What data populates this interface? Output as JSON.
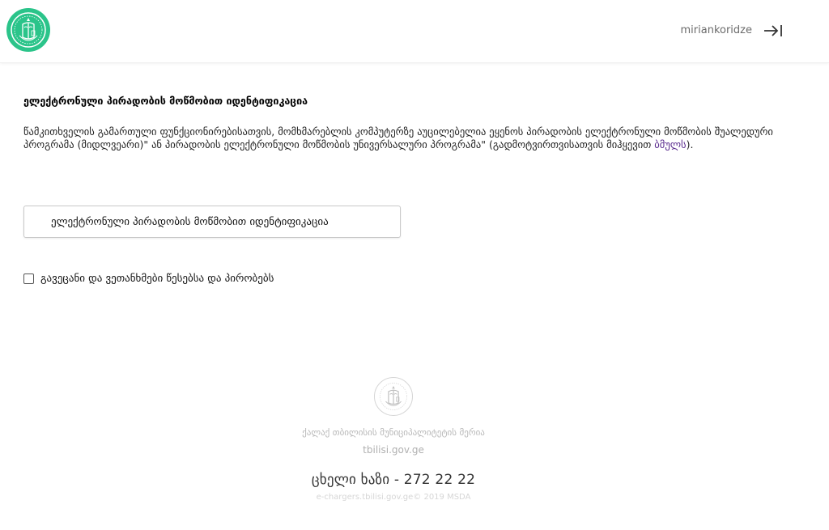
{
  "header": {
    "username": "miriankoridze",
    "logo_icon": "tbilisi-city-hall-emblem",
    "logout_icon": "logout-arrow-icon",
    "brand_color": "#2bc48a"
  },
  "main": {
    "title": "ელექტრონული პირადობის მოწმობით იდენტიფიკაცია",
    "description_text": "წამკითხველის გამართული ფუნქციონირებისათვის, მომხმარებლის კომპუტერზე აუცილებელია ეყენოს პირადობის ელექტრონული მოწმობის შუალედური პროგრამა (მიდლვეარი)\" ან პირადობის ელექტრონული მოწმობის უნივერსალური პროგრამა\" (გადმოტვირთვისათვის მიჰყევით ",
    "description_link": "ბმულს",
    "description_end": ").",
    "id_button_label": "ელექტრონული პირადობის მოწმობით იდენტიფიკაცია",
    "terms_label": "გავეცანი და ვეთანხმები წესებსა და პირობებს",
    "terms_checked": false
  },
  "footer": {
    "org_name": "ქალაქ თბილისის მუნიციპალიტეტის მერია",
    "domain": "tbilisi.gov.ge",
    "hotline": "ცხელი ხაზი - 272 22 22",
    "copyright": "e-chargers.tbilisi.gov.ge© 2019 MSDA",
    "logo_icon": "tbilisi-city-hall-emblem"
  }
}
